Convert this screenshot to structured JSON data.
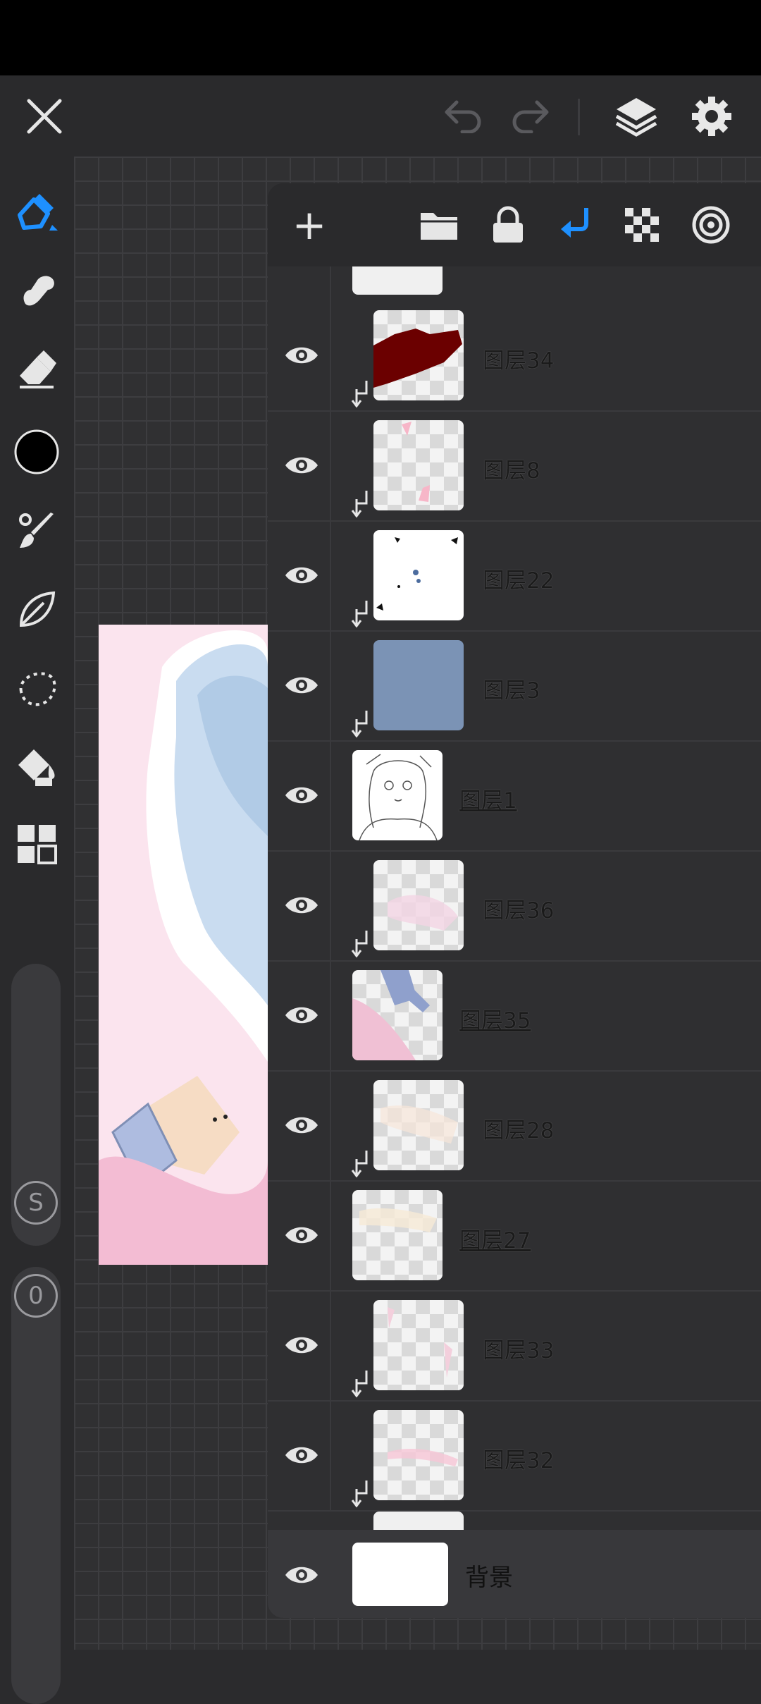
{
  "toolbar": {
    "close": "close",
    "undo": "undo",
    "redo": "redo",
    "layers": "layers",
    "settings": "settings"
  },
  "left_tools": [
    "brush",
    "smudge",
    "eraser",
    "color",
    "paint-brush",
    "leaf-stabilizer",
    "lasso",
    "fill",
    "grid-menu"
  ],
  "sliders": {
    "size_label": "S",
    "opacity_label": "0"
  },
  "layers_panel": {
    "add_label": "+",
    "layers": [
      {
        "name": "图层34",
        "clipped": true
      },
      {
        "name": "图层8",
        "clipped": true
      },
      {
        "name": "图层22",
        "clipped": true
      },
      {
        "name": "图层3",
        "clipped": true
      },
      {
        "name": "图层1",
        "clipped": false
      },
      {
        "name": "图层36",
        "clipped": true
      },
      {
        "name": "图层35",
        "clipped": false
      },
      {
        "name": "图层28",
        "clipped": true
      },
      {
        "name": "图层27",
        "clipped": false
      },
      {
        "name": "图层33",
        "clipped": true
      },
      {
        "name": "图层32",
        "clipped": true
      }
    ],
    "background_name": "背景"
  },
  "colors": {
    "accent": "#1e90ff",
    "current_color": "#000000",
    "layer34_fill": "#6b0000",
    "layer3_fill": "#7b93b5"
  }
}
